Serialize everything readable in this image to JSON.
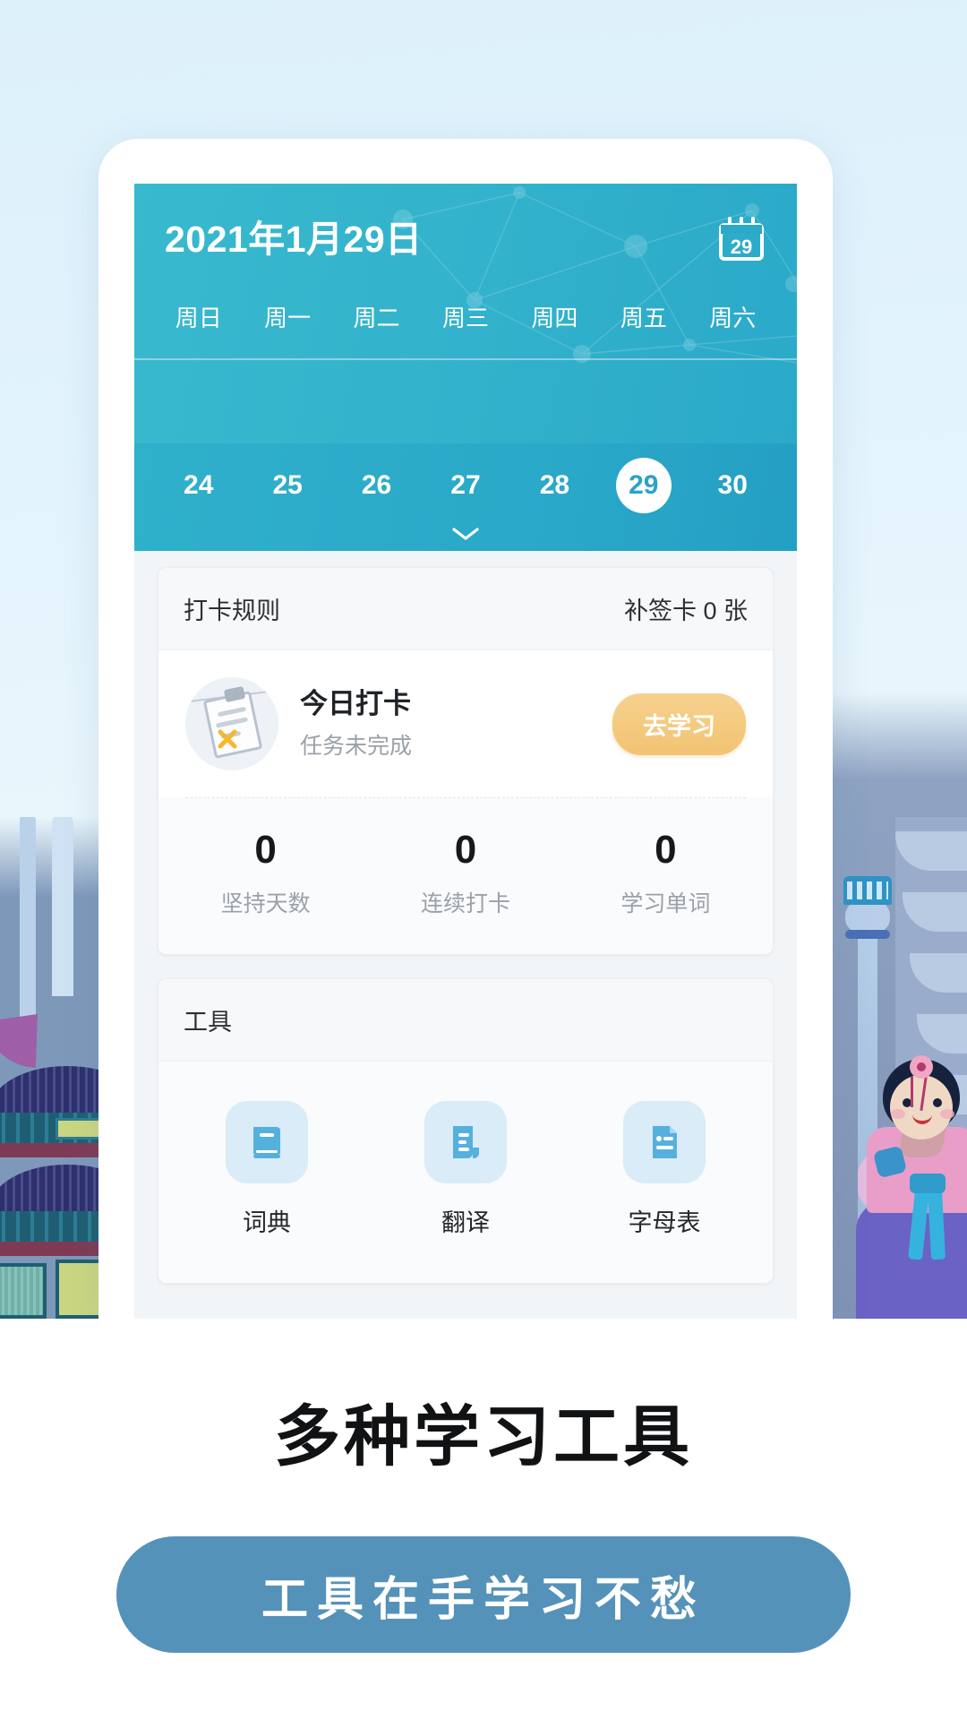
{
  "header": {
    "date_title": "2021年1月29日",
    "calendar_icon_day": "29",
    "weekdays": [
      "周日",
      "周一",
      "周二",
      "周三",
      "周四",
      "周五",
      "周六"
    ],
    "dates": [
      "24",
      "25",
      "26",
      "27",
      "28",
      "29",
      "30"
    ],
    "selected_date": "29",
    "accent_color": "#2ba9c9"
  },
  "checkin_card": {
    "rules_label": "打卡规则",
    "makeup_cards_label": "补签卡 0 张",
    "today_title": "今日打卡",
    "today_status": "任务未完成",
    "action_label": "去学习",
    "action_color": "#f2c473",
    "stats": [
      {
        "value": "0",
        "label": "坚持天数"
      },
      {
        "value": "0",
        "label": "连续打卡"
      },
      {
        "value": "0",
        "label": "学习单词"
      }
    ]
  },
  "tools_card": {
    "title": "工具",
    "items": [
      {
        "label": "词典",
        "icon": "book-icon"
      },
      {
        "label": "翻译",
        "icon": "translate-document-icon"
      },
      {
        "label": "字母表",
        "icon": "file-text-icon"
      }
    ],
    "icon_color": "#56b0de",
    "icon_bg_color": "#d9ecf7"
  },
  "promo": {
    "title": "多种学习工具",
    "button_label": "工具在手学习不愁",
    "button_color": "#5592b9"
  }
}
